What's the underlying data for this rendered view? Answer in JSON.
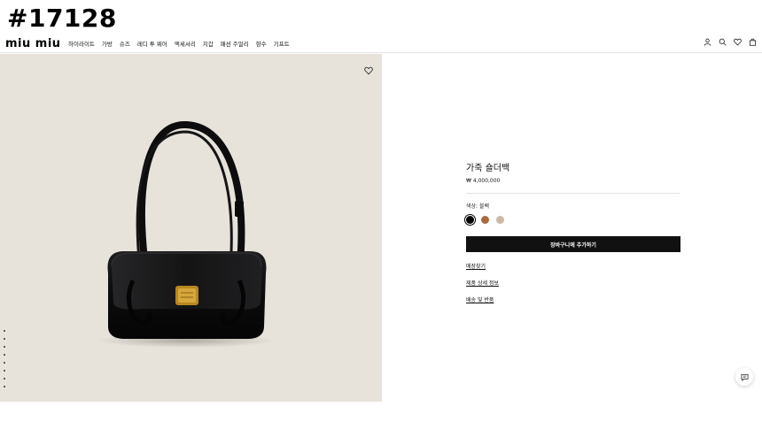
{
  "watermark": "#17128",
  "brand": {
    "logo": "miu miu"
  },
  "nav": {
    "items": [
      "하이라이트",
      "가방",
      "슈즈",
      "레디 투 웨어",
      "액세서리",
      "지갑",
      "패션 주얼리",
      "향수",
      "기프트"
    ]
  },
  "header_icons": [
    "user-icon",
    "search-icon",
    "heart-icon",
    "shopping-bag-icon"
  ],
  "product": {
    "title": "가죽 숄더백",
    "price": "₩ 4,000,000",
    "color_label": "색상: 블랙",
    "colors": [
      "#000000",
      "#a86a3e",
      "#c9b9a6"
    ],
    "selected_color_index": 0,
    "add_to_cart": "장바구니에 추가하기",
    "links": [
      "매장찾기",
      "제품 상세 정보",
      "배송 및 반품"
    ]
  },
  "gallery": {
    "image_count": 8,
    "current_index": 0,
    "background": "#e7e2da"
  }
}
